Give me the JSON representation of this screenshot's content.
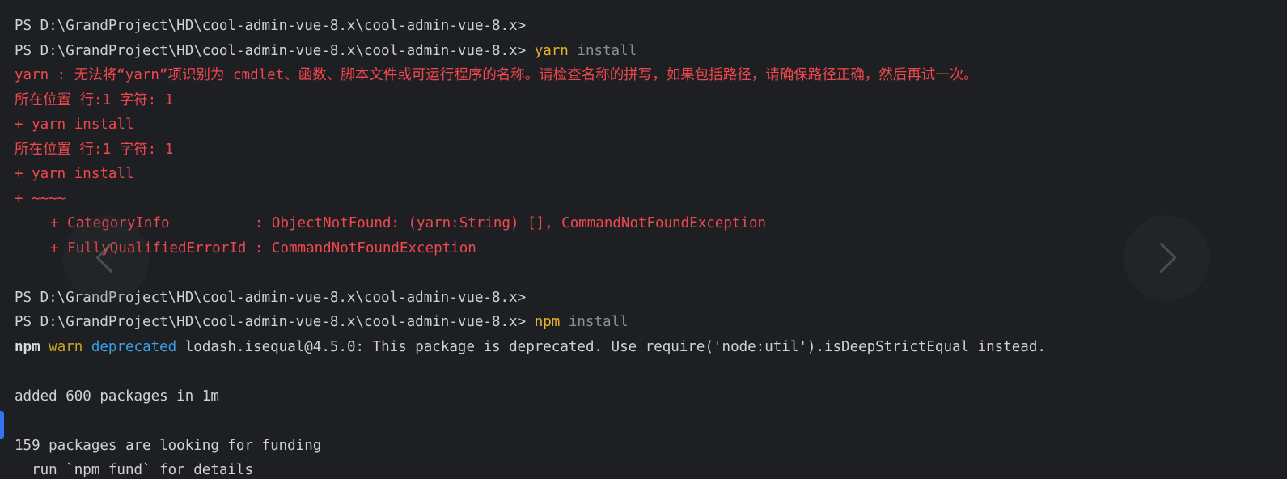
{
  "terminal": {
    "lines": [
      {
        "prompt": "PS D:\\GrandProject\\HD\\cool-admin-vue-8.x\\cool-admin-vue-8.x>"
      },
      {
        "prompt": "PS D:\\GrandProject\\HD\\cool-admin-vue-8.x\\cool-admin-vue-8.x>",
        "cmd": "yarn",
        "arg": "install"
      },
      {
        "error": "yarn : 无法将“yarn”项识别为 cmdlet、函数、脚本文件或可运行程序的名称。请检查名称的拼写，如果包括路径，请确保路径正确，然后再试一次。"
      },
      {
        "error": "所在位置 行:1 字符: 1"
      },
      {
        "error": "+ yarn install"
      },
      {
        "error": "所在位置 行:1 字符: 1"
      },
      {
        "error": "+ yarn install"
      },
      {
        "error": "+ ~~~~"
      },
      {
        "error_indent": "+ CategoryInfo          : ObjectNotFound: (yarn:String) [], CommandNotFoundException"
      },
      {
        "error_indent": "+ FullyQualifiedErrorId : CommandNotFoundException"
      },
      {
        "blank": ""
      },
      {
        "prompt": "PS D:\\GrandProject\\HD\\cool-admin-vue-8.x\\cool-admin-vue-8.x>"
      },
      {
        "prompt": "PS D:\\GrandProject\\HD\\cool-admin-vue-8.x\\cool-admin-vue-8.x>",
        "cmd": "npm",
        "arg": "install"
      },
      {
        "npm": "npm",
        "warn": "warn",
        "deprecated": "deprecated",
        "message": "lodash.isequal@4.5.0: This package is deprecated. Use require('node:util').isDeepStrictEqual instead."
      },
      {
        "blank": ""
      },
      {
        "text": "added 600 packages in 1m"
      },
      {
        "blank": ""
      },
      {
        "text": "159 packages are looking for funding"
      },
      {
        "text": "  run `npm fund` for details"
      }
    ]
  },
  "navigation": {
    "prev_icon": "chevron-left-icon",
    "next_icon": "chevron-right-icon"
  },
  "colors": {
    "background": "#1e1f22",
    "text": "#cfd1d6",
    "error": "#f0484f",
    "command": "#e8b32c",
    "argument": "#8c8f94",
    "deprecated": "#3aa2ea"
  }
}
